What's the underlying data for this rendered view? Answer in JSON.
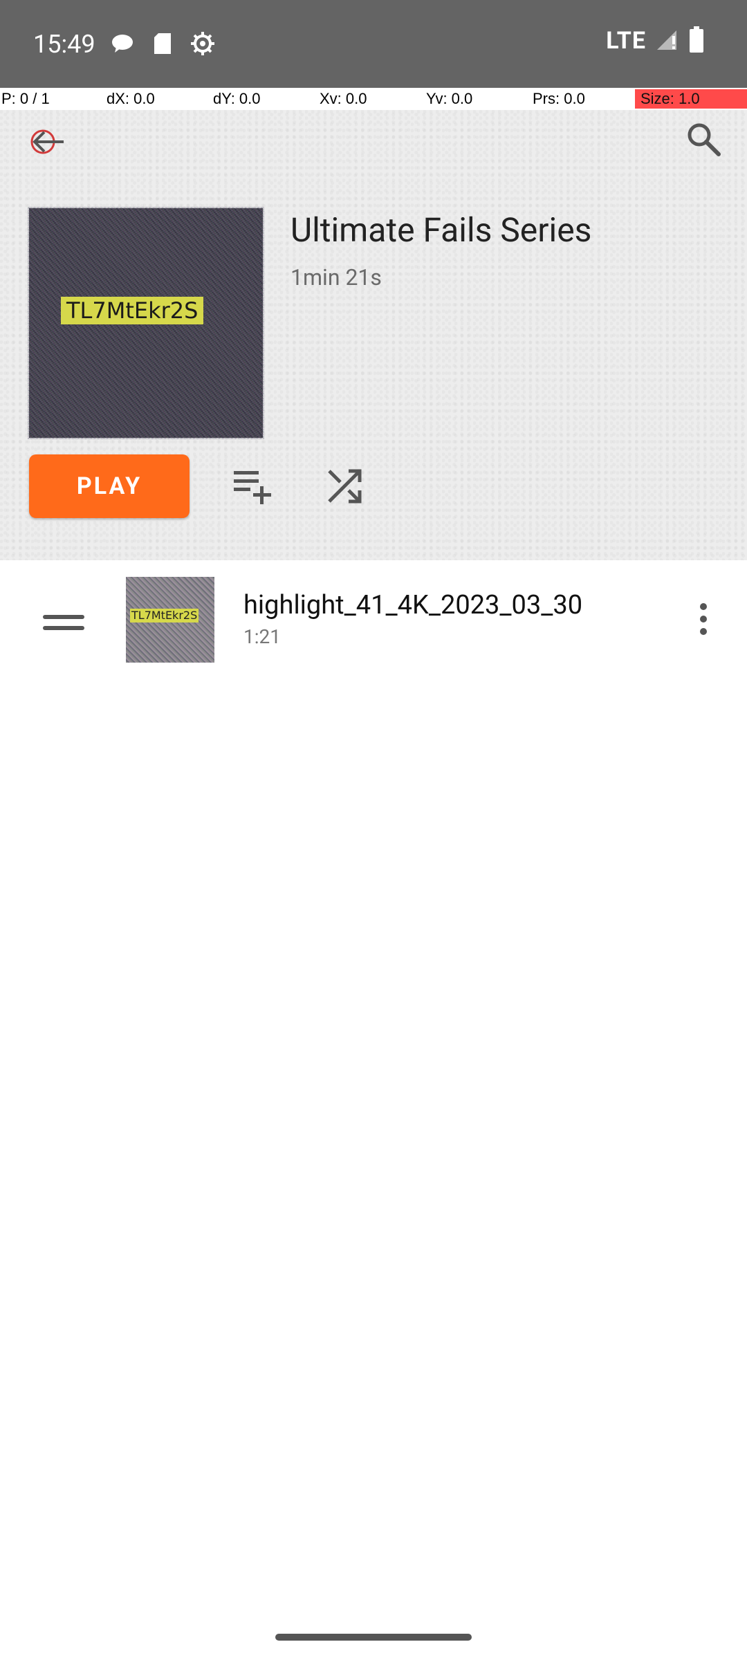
{
  "status_bar": {
    "time": "15:49",
    "network": "LTE",
    "icons": [
      "message-icon",
      "sd-card-icon",
      "settings-icon",
      "signal-icon",
      "battery-icon"
    ]
  },
  "debug": {
    "pointer": "P: 0 / 1",
    "dx": "dX: 0.0",
    "dy": "dY: 0.0",
    "xv": "Xv: 0.0",
    "yv": "Yv: 0.0",
    "prs": "Prs: 0.0",
    "size": "Size: 1.0"
  },
  "header": {
    "title": "Ultimate Fails Series",
    "duration": "1min 21s",
    "cover_text": "TL7MtEkr2S",
    "play_label": "PLAY"
  },
  "playlist": {
    "items": [
      {
        "title": "highlight_41_4K_2023_03_30",
        "duration": "1:21",
        "thumb_text": "TL7MtEkr2S"
      }
    ]
  },
  "colors": {
    "accent": "#ff6a1a",
    "statusbar": "#646464",
    "header_bg": "#ededed"
  }
}
